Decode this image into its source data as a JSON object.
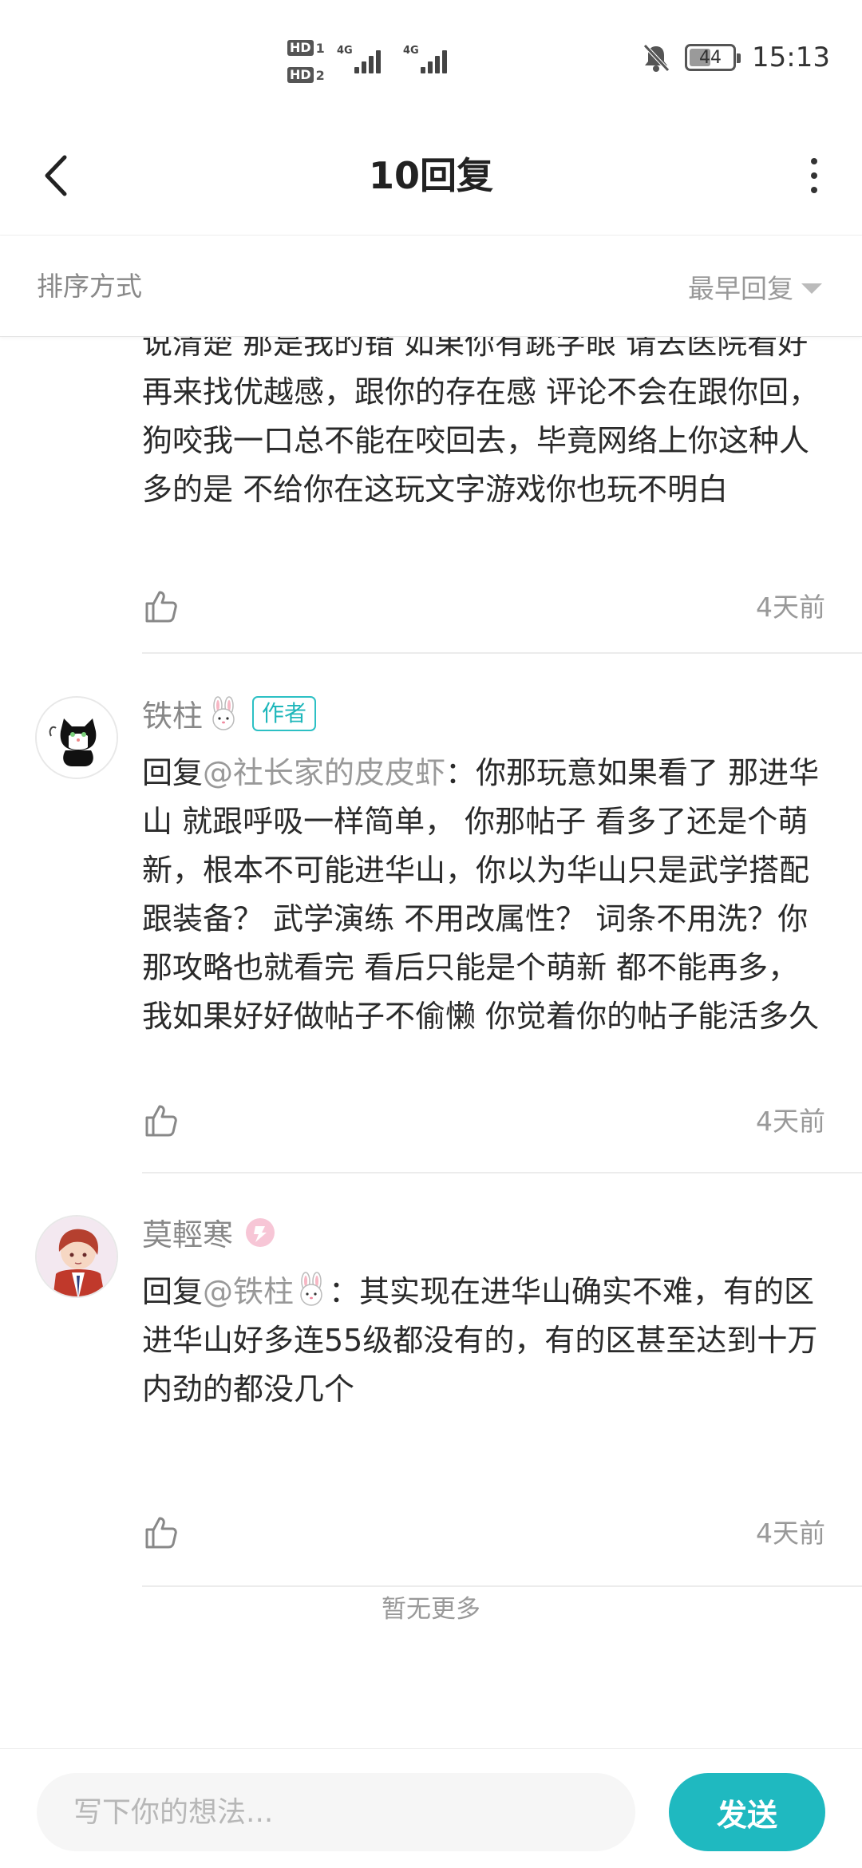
{
  "status_bar": {
    "sim1": {
      "hd": "HD",
      "slot": "1",
      "network": "4G"
    },
    "sim2": {
      "hd": "HD",
      "slot": "2",
      "network": "4G"
    },
    "battery": "44",
    "time": "15:13"
  },
  "header": {
    "title": "10回复"
  },
  "sort": {
    "label": "排序方式",
    "value": "最早回复"
  },
  "replies": [
    {
      "body": "说清楚 那是我的错 如果你有跳字眼 请去医院看好再来找优越感，跟你的存在感 评论不会在跟你回，狗咬我一口总不能在咬回去，毕竟网络上你这种人多的是 不给你在这玩文字游戏你也玩不明白",
      "time": "4天前"
    },
    {
      "name": "铁柱",
      "badge": "作者",
      "reply_prefix": "回复",
      "mention": "@社长家的皮皮虾",
      "body": "：你那玩意如果看了 那进华山 就跟呼吸一样简单， 你那帖子 看多了还是个萌新，根本不可能进华山，你以为华山只是武学搭配 跟装备？  武学演练 不用改属性？ 词条不用洗？你那攻略也就看完 看后只能是个萌新 都不能再多，我如果好好做帖子不偷懒 你觉着你的帖子能活多久",
      "time": "4天前"
    },
    {
      "name": "莫輕寒",
      "reply_prefix": "回复",
      "mention": "@铁柱",
      "body": "：其实现在进华山确实不难，有的区进华山好多连55级都没有的，有的区甚至达到十万内劲的都没几个",
      "time": "4天前"
    }
  ],
  "footer_note": "暂无更多",
  "composer": {
    "placeholder": "写下你的想法...",
    "send_label": "发送"
  },
  "colors": {
    "accent": "#1fb9c0",
    "muted_text": "#999999",
    "body_text": "#2a2a2a"
  }
}
